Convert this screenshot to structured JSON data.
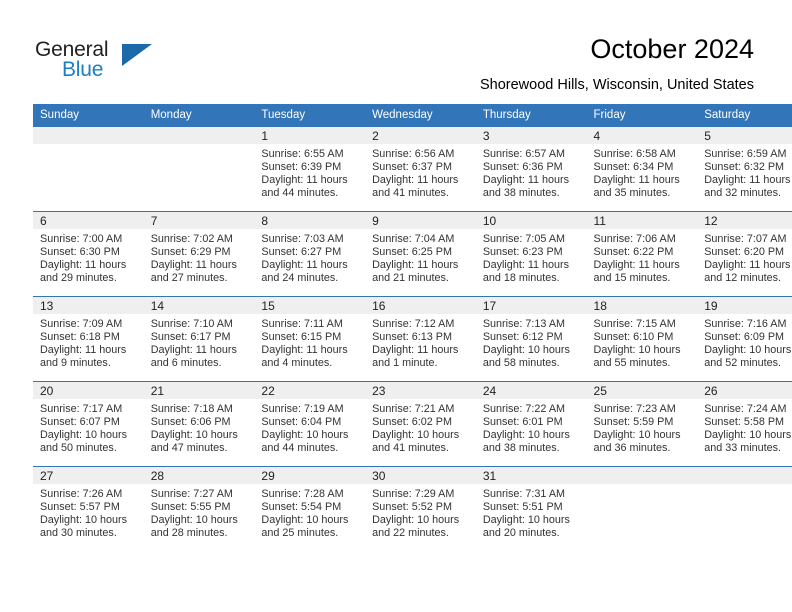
{
  "brand": {
    "name_top": "General",
    "name_bottom": "Blue",
    "color_blue": "#1c7fc4",
    "color_dark": "#231f20",
    "triangle_color": "#1b69a8"
  },
  "header": {
    "title": "October 2024",
    "subtitle": "Shorewood Hills, Wisconsin, United States"
  },
  "theme": {
    "header_bg": "#3275b8",
    "header_text": "#ffffff",
    "daynum_bg": "#efefef",
    "row_divider": "#3275b8",
    "body_text": "#333333"
  },
  "calendar": {
    "weekday_headers": [
      "Sunday",
      "Monday",
      "Tuesday",
      "Wednesday",
      "Thursday",
      "Friday",
      "Saturday"
    ],
    "weeks": [
      [
        {
          "day": "",
          "sunrise": "",
          "sunset": "",
          "daylight_line1": "",
          "daylight_line2": "",
          "empty": true
        },
        {
          "day": "",
          "sunrise": "",
          "sunset": "",
          "daylight_line1": "",
          "daylight_line2": "",
          "empty": true
        },
        {
          "day": "1",
          "sunrise": "Sunrise: 6:55 AM",
          "sunset": "Sunset: 6:39 PM",
          "daylight_line1": "Daylight: 11 hours",
          "daylight_line2": "and 44 minutes.",
          "empty": false
        },
        {
          "day": "2",
          "sunrise": "Sunrise: 6:56 AM",
          "sunset": "Sunset: 6:37 PM",
          "daylight_line1": "Daylight: 11 hours",
          "daylight_line2": "and 41 minutes.",
          "empty": false
        },
        {
          "day": "3",
          "sunrise": "Sunrise: 6:57 AM",
          "sunset": "Sunset: 6:36 PM",
          "daylight_line1": "Daylight: 11 hours",
          "daylight_line2": "and 38 minutes.",
          "empty": false
        },
        {
          "day": "4",
          "sunrise": "Sunrise: 6:58 AM",
          "sunset": "Sunset: 6:34 PM",
          "daylight_line1": "Daylight: 11 hours",
          "daylight_line2": "and 35 minutes.",
          "empty": false
        },
        {
          "day": "5",
          "sunrise": "Sunrise: 6:59 AM",
          "sunset": "Sunset: 6:32 PM",
          "daylight_line1": "Daylight: 11 hours",
          "daylight_line2": "and 32 minutes.",
          "empty": false
        }
      ],
      [
        {
          "day": "6",
          "sunrise": "Sunrise: 7:00 AM",
          "sunset": "Sunset: 6:30 PM",
          "daylight_line1": "Daylight: 11 hours",
          "daylight_line2": "and 29 minutes.",
          "empty": false
        },
        {
          "day": "7",
          "sunrise": "Sunrise: 7:02 AM",
          "sunset": "Sunset: 6:29 PM",
          "daylight_line1": "Daylight: 11 hours",
          "daylight_line2": "and 27 minutes.",
          "empty": false
        },
        {
          "day": "8",
          "sunrise": "Sunrise: 7:03 AM",
          "sunset": "Sunset: 6:27 PM",
          "daylight_line1": "Daylight: 11 hours",
          "daylight_line2": "and 24 minutes.",
          "empty": false
        },
        {
          "day": "9",
          "sunrise": "Sunrise: 7:04 AM",
          "sunset": "Sunset: 6:25 PM",
          "daylight_line1": "Daylight: 11 hours",
          "daylight_line2": "and 21 minutes.",
          "empty": false
        },
        {
          "day": "10",
          "sunrise": "Sunrise: 7:05 AM",
          "sunset": "Sunset: 6:23 PM",
          "daylight_line1": "Daylight: 11 hours",
          "daylight_line2": "and 18 minutes.",
          "empty": false
        },
        {
          "day": "11",
          "sunrise": "Sunrise: 7:06 AM",
          "sunset": "Sunset: 6:22 PM",
          "daylight_line1": "Daylight: 11 hours",
          "daylight_line2": "and 15 minutes.",
          "empty": false
        },
        {
          "day": "12",
          "sunrise": "Sunrise: 7:07 AM",
          "sunset": "Sunset: 6:20 PM",
          "daylight_line1": "Daylight: 11 hours",
          "daylight_line2": "and 12 minutes.",
          "empty": false
        }
      ],
      [
        {
          "day": "13",
          "sunrise": "Sunrise: 7:09 AM",
          "sunset": "Sunset: 6:18 PM",
          "daylight_line1": "Daylight: 11 hours",
          "daylight_line2": "and 9 minutes.",
          "empty": false
        },
        {
          "day": "14",
          "sunrise": "Sunrise: 7:10 AM",
          "sunset": "Sunset: 6:17 PM",
          "daylight_line1": "Daylight: 11 hours",
          "daylight_line2": "and 6 minutes.",
          "empty": false
        },
        {
          "day": "15",
          "sunrise": "Sunrise: 7:11 AM",
          "sunset": "Sunset: 6:15 PM",
          "daylight_line1": "Daylight: 11 hours",
          "daylight_line2": "and 4 minutes.",
          "empty": false
        },
        {
          "day": "16",
          "sunrise": "Sunrise: 7:12 AM",
          "sunset": "Sunset: 6:13 PM",
          "daylight_line1": "Daylight: 11 hours",
          "daylight_line2": "and 1 minute.",
          "empty": false
        },
        {
          "day": "17",
          "sunrise": "Sunrise: 7:13 AM",
          "sunset": "Sunset: 6:12 PM",
          "daylight_line1": "Daylight: 10 hours",
          "daylight_line2": "and 58 minutes.",
          "empty": false
        },
        {
          "day": "18",
          "sunrise": "Sunrise: 7:15 AM",
          "sunset": "Sunset: 6:10 PM",
          "daylight_line1": "Daylight: 10 hours",
          "daylight_line2": "and 55 minutes.",
          "empty": false
        },
        {
          "day": "19",
          "sunrise": "Sunrise: 7:16 AM",
          "sunset": "Sunset: 6:09 PM",
          "daylight_line1": "Daylight: 10 hours",
          "daylight_line2": "and 52 minutes.",
          "empty": false
        }
      ],
      [
        {
          "day": "20",
          "sunrise": "Sunrise: 7:17 AM",
          "sunset": "Sunset: 6:07 PM",
          "daylight_line1": "Daylight: 10 hours",
          "daylight_line2": "and 50 minutes.",
          "empty": false
        },
        {
          "day": "21",
          "sunrise": "Sunrise: 7:18 AM",
          "sunset": "Sunset: 6:06 PM",
          "daylight_line1": "Daylight: 10 hours",
          "daylight_line2": "and 47 minutes.",
          "empty": false
        },
        {
          "day": "22",
          "sunrise": "Sunrise: 7:19 AM",
          "sunset": "Sunset: 6:04 PM",
          "daylight_line1": "Daylight: 10 hours",
          "daylight_line2": "and 44 minutes.",
          "empty": false
        },
        {
          "day": "23",
          "sunrise": "Sunrise: 7:21 AM",
          "sunset": "Sunset: 6:02 PM",
          "daylight_line1": "Daylight: 10 hours",
          "daylight_line2": "and 41 minutes.",
          "empty": false
        },
        {
          "day": "24",
          "sunrise": "Sunrise: 7:22 AM",
          "sunset": "Sunset: 6:01 PM",
          "daylight_line1": "Daylight: 10 hours",
          "daylight_line2": "and 38 minutes.",
          "empty": false
        },
        {
          "day": "25",
          "sunrise": "Sunrise: 7:23 AM",
          "sunset": "Sunset: 5:59 PM",
          "daylight_line1": "Daylight: 10 hours",
          "daylight_line2": "and 36 minutes.",
          "empty": false
        },
        {
          "day": "26",
          "sunrise": "Sunrise: 7:24 AM",
          "sunset": "Sunset: 5:58 PM",
          "daylight_line1": "Daylight: 10 hours",
          "daylight_line2": "and 33 minutes.",
          "empty": false
        }
      ],
      [
        {
          "day": "27",
          "sunrise": "Sunrise: 7:26 AM",
          "sunset": "Sunset: 5:57 PM",
          "daylight_line1": "Daylight: 10 hours",
          "daylight_line2": "and 30 minutes.",
          "empty": false
        },
        {
          "day": "28",
          "sunrise": "Sunrise: 7:27 AM",
          "sunset": "Sunset: 5:55 PM",
          "daylight_line1": "Daylight: 10 hours",
          "daylight_line2": "and 28 minutes.",
          "empty": false
        },
        {
          "day": "29",
          "sunrise": "Sunrise: 7:28 AM",
          "sunset": "Sunset: 5:54 PM",
          "daylight_line1": "Daylight: 10 hours",
          "daylight_line2": "and 25 minutes.",
          "empty": false
        },
        {
          "day": "30",
          "sunrise": "Sunrise: 7:29 AM",
          "sunset": "Sunset: 5:52 PM",
          "daylight_line1": "Daylight: 10 hours",
          "daylight_line2": "and 22 minutes.",
          "empty": false
        },
        {
          "day": "31",
          "sunrise": "Sunrise: 7:31 AM",
          "sunset": "Sunset: 5:51 PM",
          "daylight_line1": "Daylight: 10 hours",
          "daylight_line2": "and 20 minutes.",
          "empty": false
        },
        {
          "day": "",
          "sunrise": "",
          "sunset": "",
          "daylight_line1": "",
          "daylight_line2": "",
          "empty": true
        },
        {
          "day": "",
          "sunrise": "",
          "sunset": "",
          "daylight_line1": "",
          "daylight_line2": "",
          "empty": true
        }
      ]
    ]
  }
}
